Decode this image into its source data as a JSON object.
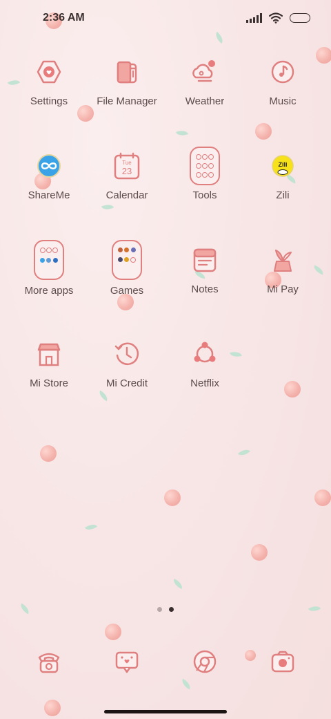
{
  "status": {
    "time": "2:36 AM"
  },
  "apps": [
    {
      "label": "Settings"
    },
    {
      "label": "File Manager"
    },
    {
      "label": "Weather"
    },
    {
      "label": "Music"
    },
    {
      "label": "ShareMe"
    },
    {
      "label": "Calendar",
      "day": "Tue",
      "date": "23"
    },
    {
      "label": "Tools"
    },
    {
      "label": "Zili",
      "badge": "Zili"
    },
    {
      "label": "More apps"
    },
    {
      "label": "Games"
    },
    {
      "label": "Notes"
    },
    {
      "label": "Mi Pay"
    },
    {
      "label": "Mi Store"
    },
    {
      "label": "Mi Credit"
    },
    {
      "label": "Netflix"
    }
  ],
  "dock": [
    {
      "icon": "phone-icon"
    },
    {
      "icon": "messages-icon"
    },
    {
      "icon": "browser-icon"
    },
    {
      "icon": "camera-icon"
    }
  ],
  "pager": {
    "pages": 2,
    "current": 2
  },
  "colors": {
    "accent": "#e07f7f",
    "background": "#f7e4e4",
    "text": "#5c4b4b"
  }
}
